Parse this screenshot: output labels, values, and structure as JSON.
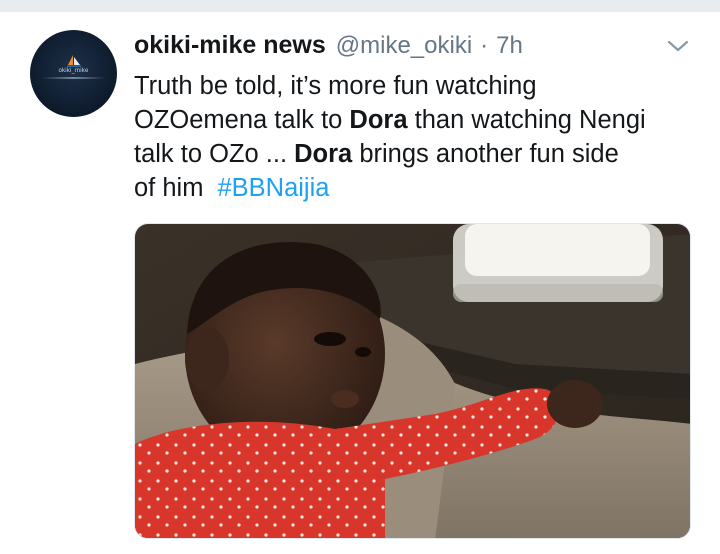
{
  "tweet": {
    "display_name": "okiki-mike news",
    "handle": "@mike_okiki",
    "separator": "·",
    "time": "7h",
    "text": {
      "line1": "Truth be told, it’s more fun watching",
      "line2_a": "OZOemena talk to ",
      "line2_bold": "Dora",
      "line2_b": " than watching Nengi",
      "line3_a": "talk to OZo ... ",
      "line3_bold": "Dora",
      "line3_b": " brings another fun side",
      "line4_a": "of him",
      "hashtag": "#BBNaijia"
    },
    "avatar": {
      "brand": "okiki_mike"
    }
  },
  "icons": {
    "caret": "chevron-down-icon",
    "avatar_logo": "sail-logo-icon"
  },
  "colors": {
    "link": "#1da1f2",
    "secondary_text": "#657786",
    "divider": "#e6ecf0"
  }
}
